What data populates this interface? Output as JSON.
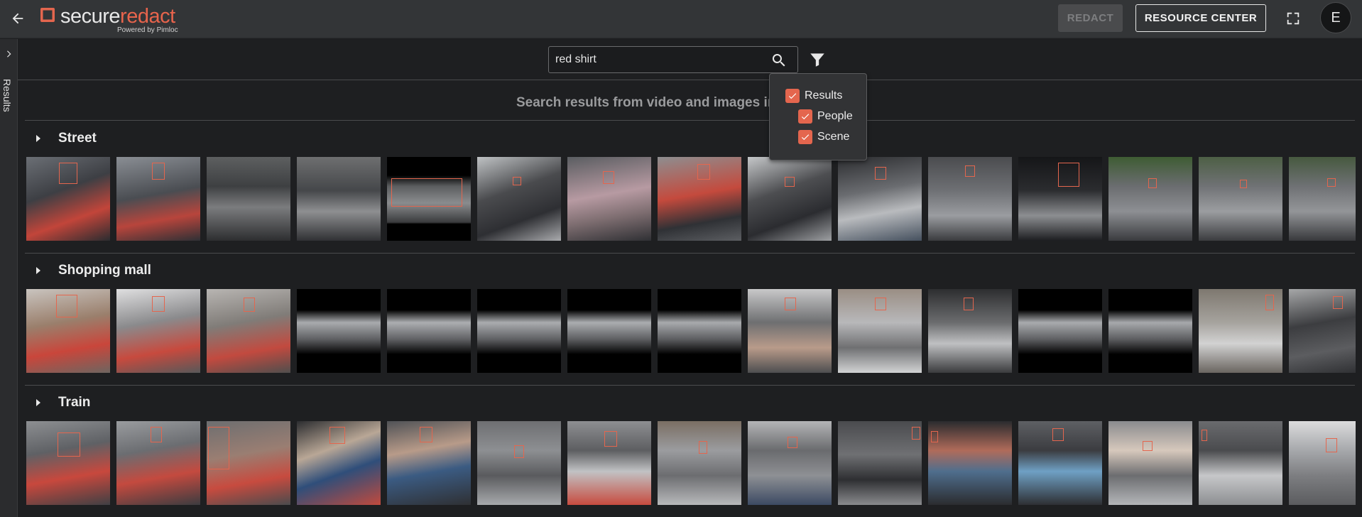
{
  "app": {
    "logo_word1": "secure",
    "logo_word2": "redact",
    "logo_sub": "Powered by Pimloc",
    "brand_color": "#e4664e"
  },
  "header": {
    "redact_label": "REDACT",
    "resource_label": "RESOURCE CENTER",
    "avatar_initial": "E"
  },
  "sidebar": {
    "label": "Results"
  },
  "search": {
    "value": "red shirt",
    "heading": "Search results from video and images in"
  },
  "filter": {
    "items": [
      {
        "label": "Results",
        "checked": true
      },
      {
        "label": "People",
        "checked": true
      },
      {
        "label": "Scene",
        "checked": true
      }
    ]
  },
  "sections": [
    {
      "title": "Street",
      "thumbs": [
        {
          "bg": "linear-gradient(160deg,#6b6f75 0%,#3d3f44 40%,#c2453a 70%,#2a2c30 100%)"
        },
        {
          "bg": "linear-gradient(170deg,#8a8e94 0%,#4a4d52 45%,#b8453c 72%,#2e3035 100%)"
        },
        {
          "bg": "linear-gradient(180deg,#5d5f60 0%,#3e4042 35%,#7b7c7e 60%,#2d2e30 100%)"
        },
        {
          "bg": "linear-gradient(180deg,#6e6f70 0%,#45474a 40%,#8e8f91 65%,#303134 100%)"
        },
        {
          "bg": "linear-gradient(180deg,#000 0%,#000 22%,#5c5e60 35%,#8a8c8e 55%,#3a3b3d 78%,#000 80%,#000 100%)"
        },
        {
          "bg": "linear-gradient(160deg,#bfc2c4 0%,#4a4b4e 40%,#2e2f33 70%,#a9aaad 100%)"
        },
        {
          "bg": "linear-gradient(170deg,#5a5d61 0%,#b79aa2 45%,#7d6d70 70%,#2f3034 100%)"
        },
        {
          "bg": "linear-gradient(170deg,#8d8e90 0%,#c44a3d 45%,#2f3135 75%,#5c5e62 100%)"
        },
        {
          "bg": "linear-gradient(160deg,#c5c7c9 0%,#4d4e51 40%,#2b2c30 70%,#9d9fa2 100%)"
        },
        {
          "bg": "linear-gradient(170deg,#2c2d30 0%,#6a6c70 40%,#b9bbbe 65%,#45505e 100%)"
        },
        {
          "bg": "linear-gradient(180deg,#4b4c4f 0%,#6e7074 40%,#9a9ca0 70%,#3a3b3e 100%)"
        },
        {
          "bg": "linear-gradient(180deg,#151618 0%,#2b2c2f 40%,#8c8e91 70%,#1c1d20 100%)"
        },
        {
          "bg": "linear-gradient(180deg,#3e5c33 0%,#6b6d70 35%,#8d8f93 65%,#3a3b3e 100%)"
        },
        {
          "bg": "linear-gradient(180deg,#4d5f45 0%,#707275 35%,#9b9da0 65%,#3b3c3f 100%)"
        },
        {
          "bg": "linear-gradient(180deg,#46593f 0%,#6f7174 35%,#939598 65%,#38393c 100%)"
        }
      ]
    },
    {
      "title": "Shopping mall",
      "thumbs": [
        {
          "bg": "linear-gradient(170deg,#c9c4bf 0%,#9a7f6c 40%,#c9463b 70%,#6d6560 100%)"
        },
        {
          "bg": "linear-gradient(170deg,#dfdfe0 0%,#8a8a8c 40%,#c74a3e 72%,#575859 100%)"
        },
        {
          "bg": "linear-gradient(170deg,#b8b5b2 0%,#807c78 40%,#c24a3f 72%,#4f4e4d 100%)"
        },
        {
          "bg": "linear-gradient(180deg,#000 0%,#000 25%,#a9abae 40%,#5e5f62 60%,#000 78%,#000 100%)"
        },
        {
          "bg": "linear-gradient(180deg,#000 0%,#000 25%,#acaeb1 40%,#606164 60%,#000 78%,#000 100%)"
        },
        {
          "bg": "linear-gradient(180deg,#000 0%,#000 25%,#aaacaf 40%,#5f6063 60%,#000 78%,#000 100%)"
        },
        {
          "bg": "linear-gradient(180deg,#000 0%,#000 25%,#abadb0 40%,#5d5e61 60%,#000 78%,#000 100%)"
        },
        {
          "bg": "linear-gradient(180deg,#000 0%,#000 25%,#a8aaad 40%,#5c5d60 60%,#000 78%,#000 100%)"
        },
        {
          "bg": "linear-gradient(180deg,#c8c8c9 0%,#6e6f71 40%,#b99b8a 70%,#4d4e50 100%)"
        },
        {
          "bg": "linear-gradient(180deg,#9a8e84 0%,#b8b8ba 40%,#6f7072 70%,#d2d3d4 100%)"
        },
        {
          "bg": "linear-gradient(180deg,#2d2e30 0%,#6b6c6e 40%,#bfc0c2 65%,#3a3b3d 100%)"
        },
        {
          "bg": "linear-gradient(180deg,#000 0%,#000 25%,#a9abae 40%,#5e5f62 60%,#000 78%,#000 100%)"
        },
        {
          "bg": "linear-gradient(180deg,#000 0%,#000 25%,#a7a9ac 40%,#5c5d60 60%,#000 78%,#000 100%)"
        },
        {
          "bg": "linear-gradient(180deg,#7e786f 0%,#a6a39e 40%,#d2d2d2 65%,#6a6560 100%)"
        },
        {
          "bg": "linear-gradient(170deg,#a6a7a8 0%,#3c3d40 40%,#5c5d60 70%,#2b2c2f 100%)"
        }
      ]
    },
    {
      "title": "Train",
      "thumbs": [
        {
          "bg": "linear-gradient(170deg,#8d8f92 0%,#5f6165 35%,#c8483d 65%,#3f4044 100%)"
        },
        {
          "bg": "linear-gradient(170deg,#9a9c9f 0%,#6b6d71 35%,#c44a3f 65%,#3b3c40 100%)"
        },
        {
          "bg": "linear-gradient(170deg,#6d6e70 0%,#9a7e72 40%,#c74b3f 70%,#4a4b4d 100%)"
        },
        {
          "bg": "linear-gradient(160deg,#2c2d30 0%,#b9a796 35%,#2f4e7a 60%,#c14a3d 100%)"
        },
        {
          "bg": "linear-gradient(170deg,#505256 0%,#b89b89 35%,#3b5b82 60%,#2f3033 100%)"
        },
        {
          "bg": "linear-gradient(180deg,#6e6f72 0%,#8d8f92 35%,#5a5b5e 65%,#a7a9ac 100%)"
        },
        {
          "bg": "linear-gradient(180deg,#8e8f92 0%,#5d5e61 35%,#c1c2c4 60%,#c74b3f 100%)"
        },
        {
          "bg": "linear-gradient(180deg,#7a6e63 0%,#9b9c9f 35%,#6c6d70 65%,#b8b9bb 100%)"
        },
        {
          "bg": "linear-gradient(180deg,#b4b5b7 0%,#6a6b6e 35%,#8e9094 65%,#3c4a63 100%)"
        },
        {
          "bg": "linear-gradient(180deg,#4a4b4e 0%,#6f7073 40%,#2e2f32 70%,#8a8b8e 100%)"
        },
        {
          "bg": "linear-gradient(180deg,#2a2b2e 0%,#b06b5a 35%,#4f6e8d 60%,#2b2c2f 100%)"
        },
        {
          "bg": "linear-gradient(180deg,#5e6064 0%,#3b3c40 35%,#6fa0c4 60%,#2e2f33 100%)"
        },
        {
          "bg": "linear-gradient(180deg,#8a8b8e 0%,#d6c8bc 35%,#6c6d70 65%,#b4b6b9 100%)"
        },
        {
          "bg": "linear-gradient(180deg,#6a6b6e 0%,#4a4b4e 35%,#c6c7c9 65%,#8d8f92 100%)"
        },
        {
          "bg": "linear-gradient(180deg,#dcdcdd 0%,#a6a8ab 35%,#7d7e81 65%,#5b5c5f 100%)"
        }
      ]
    }
  ]
}
